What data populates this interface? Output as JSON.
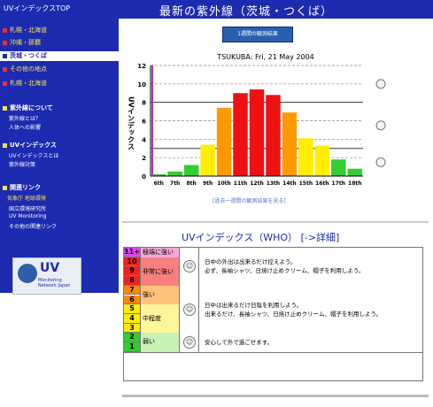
{
  "topbar": {
    "home_link": "UVインデックスTOP",
    "title": "最新の紫外線（茨城・つくば）"
  },
  "sidebar": {
    "items": [
      {
        "label": "札幌・北海道"
      },
      {
        "label": "茨城・つくば"
      },
      {
        "label": "茨城・つくば"
      },
      {
        "label": "沖縄・那覇"
      },
      {
        "label": "その他の地点"
      }
    ],
    "sections": [
      {
        "title": "紫外線について",
        "subs": [
          "紫外線とは？",
          "人体への影響"
        ]
      },
      {
        "title": "UVインデックス",
        "subs": [
          "UVインデックスとは",
          "紫外線対策"
        ]
      },
      {
        "title": "関連リンク",
        "highlight": "気象庁 地球環境",
        "subs": [
          "国立環境研究所",
          "UV Monitoring",
          "その他の関連リンク"
        ]
      }
    ],
    "logo": {
      "main": "UV",
      "sub": "Monitoring\nNetwork Japan"
    }
  },
  "main": {
    "weekly_button": "1週間の観測結果",
    "chart_link": "[過去一週間の観測結果を見る]",
    "who_title": "UVインデックス（WHO）",
    "who_detail": "[->詳細]"
  },
  "chart_data": {
    "type": "bar",
    "title": "TSUKUBA: Fri, 21 May 2004",
    "ylabel": "UVインデックス",
    "ylim": [
      0,
      12
    ],
    "yticks": [
      "0",
      "2",
      "4",
      "6",
      "8",
      "10",
      "12"
    ],
    "categories": [
      "6",
      "7",
      "8",
      "9",
      "10",
      "11",
      "12",
      "13",
      "14",
      "15",
      "16",
      "17",
      "18"
    ],
    "category_suffix": "th",
    "values": [
      0.2,
      0.5,
      1.2,
      3.4,
      7.4,
      9.0,
      9.4,
      8.8,
      6.9,
      4.1,
      3.3,
      1.8,
      0.8
    ],
    "colors": [
      "#33cc33",
      "#33cc33",
      "#33cc33",
      "#ffee00",
      "#ff9900",
      "#ee1111",
      "#ee1111",
      "#ee1111",
      "#ff9900",
      "#ffee00",
      "#ffee00",
      "#33cc33",
      "#33cc33"
    ],
    "grid": "horizontal",
    "threshold_lines": [
      3,
      8
    ],
    "icons": [
      "face-strong",
      "face-moderate",
      "face-weak"
    ]
  },
  "who_table": {
    "rows": [
      {
        "levels": [
          "11+"
        ],
        "level_colors": [
          "#dd44ee"
        ],
        "label": "極端に強い",
        "cat_color": "#f4a8d6"
      },
      {
        "levels": [
          "10",
          "9",
          "8"
        ],
        "level_colors": [
          "#ee2222",
          "#ee2222",
          "#ee2222"
        ],
        "label": "非常に強い",
        "cat_color": "#f77f7f",
        "desc": [
          "日中の外出は出来るだけ控えよう。",
          "必ず、長袖シャツ、日焼け止めクリーム、帽子を利用しよう。"
        ]
      },
      {
        "levels": [
          "7",
          "6"
        ],
        "level_colors": [
          "#ff8800",
          "#ff8800"
        ],
        "label": "強い",
        "cat_color": "#ffc47a",
        "desc": [
          "日中は出来るだけ日陰を利用しよう。",
          "出来るだけ、長袖シャツ、日焼け止めクリーム、帽子を利用しよう。"
        ]
      },
      {
        "levels": [
          "5",
          "4",
          "3"
        ],
        "level_colors": [
          "#ffee00",
          "#ffee00",
          "#ffee00"
        ],
        "label": "中程度",
        "cat_color": "#fff59a"
      },
      {
        "levels": [
          "2",
          "1"
        ],
        "level_colors": [
          "#33cc33",
          "#33cc33"
        ],
        "label": "弱い",
        "cat_color": "#c6f2b6",
        "desc": [
          "安心して外で過ごせます。"
        ]
      }
    ]
  }
}
